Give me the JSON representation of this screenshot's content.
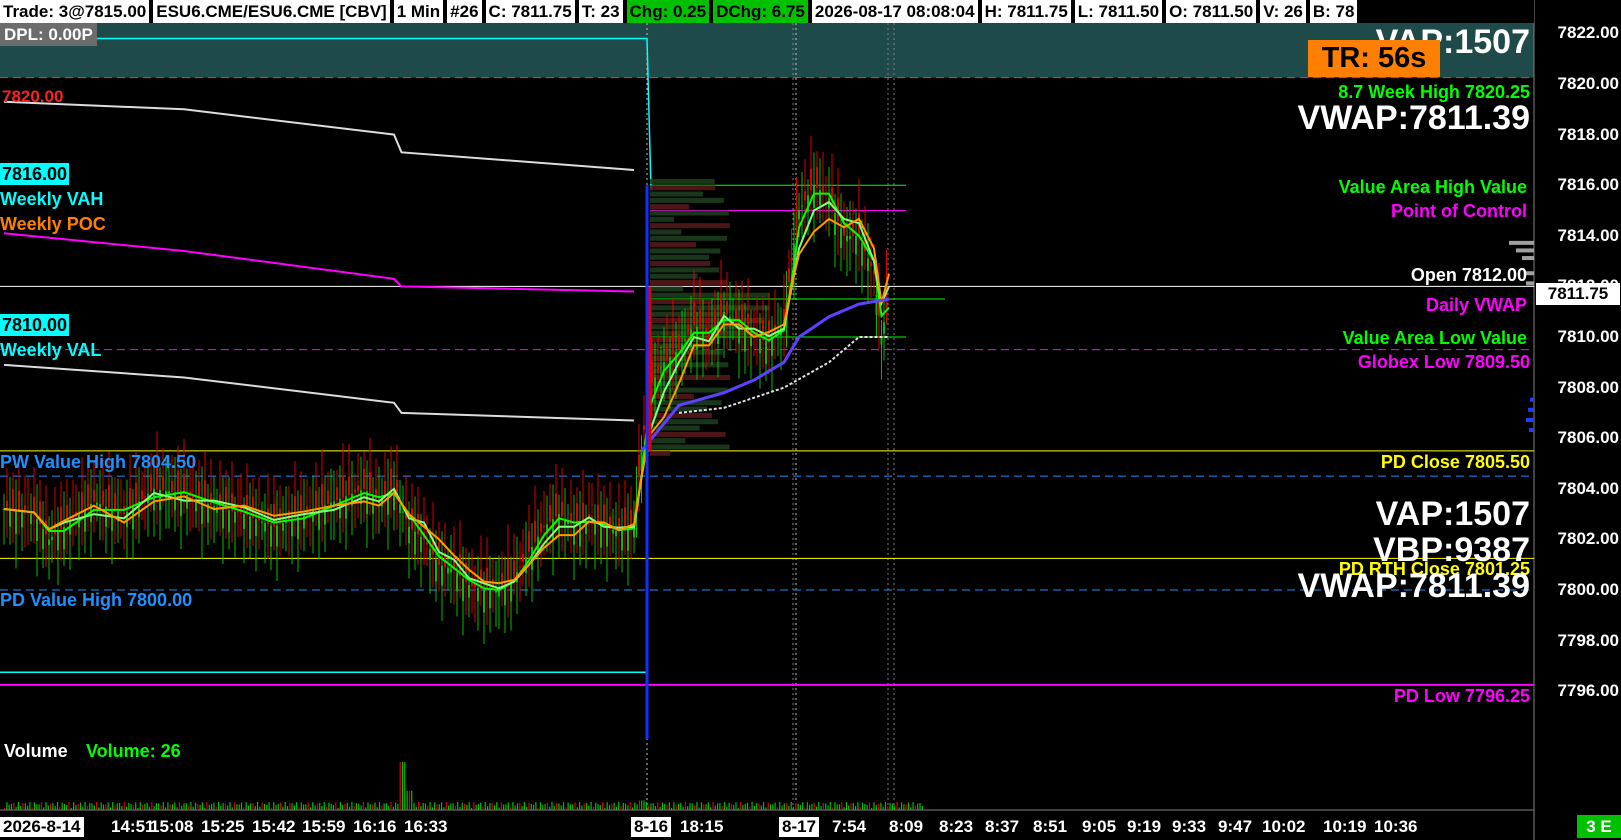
{
  "header": {
    "trade": "Trade: 3@7815.00",
    "symbol": "ESU6.CME/ESU6.CME [CBV]",
    "interval": "1 Min",
    "bar_number": "#26",
    "close": "C: 7811.75",
    "ticks": "T: 23",
    "change": "Chg: 0.25",
    "day_change": "DChg: 6.75",
    "datetime": "2026-08-17 08:08:04",
    "high": "H: 7811.75",
    "low": "L: 7811.50",
    "open": "O: 7811.50",
    "volume": "V: 26",
    "bid": "B: 78"
  },
  "dpl": "DPL: 0.00P",
  "timer": "TR: 56s",
  "stats": {
    "vap": "VAP:1507",
    "vbp": "VBP:9387",
    "vwap": "VWAP:7811.39"
  },
  "left_labels": {
    "level_7820": "7820.00",
    "level_7816": "7816.00",
    "weekly_vah": "Weekly VAH",
    "weekly_poc": "Weekly POC",
    "level_7810": "7810.00",
    "weekly_val": "Weekly VAL",
    "pw_value_high": "PW Value High  7804.50",
    "pd_value_high": "PD Value High  7800.00"
  },
  "right_labels": {
    "week_high": "8.7 Week High  7820.25",
    "vah": "Value Area High Value",
    "poc": "Point of Control",
    "open": "Open  7812.00",
    "daily_vwap": "Daily VWAP",
    "val": "Value Area Low Value",
    "globex_low": "Globex Low  7809.50",
    "pd_close": "PD Close  7805.50",
    "pd_rth_close": "PD RTH Close  7801.25",
    "pd_low": "PD Low  7796.25"
  },
  "price_axis": {
    "ticks": [
      "7822.00",
      "7820.00",
      "7818.00",
      "7816.00",
      "7814.00",
      "7812.00",
      "7810.00",
      "7808.00",
      "7806.00",
      "7804.00",
      "7802.00",
      "7800.00",
      "7798.00",
      "7796.00"
    ],
    "last_price": "7811.75"
  },
  "time_axis": {
    "labels": [
      "2026-8-14",
      "14:51",
      "15:08",
      "15:25",
      "15:42",
      "15:59",
      "16:16",
      "16:33",
      "8-16",
      "18:15",
      "8-17",
      "7:54",
      "8:09",
      "8:23",
      "8:37",
      "8:51",
      "9:05",
      "9:19",
      "9:33",
      "9:47",
      "10:02",
      "10:19",
      "10:36"
    ]
  },
  "volume_panel": {
    "title": "Volume",
    "value": "Volume: 26"
  },
  "corner": "3 E",
  "colors": {
    "background": "#000000",
    "cyan": "#00ffff",
    "magenta": "#ff00ff",
    "yellow": "#ffff00",
    "green": "#00ff00",
    "orange": "#ff8000",
    "red": "#ff0000",
    "blue": "#1e90ff",
    "teal_band": "#1f4a4a"
  },
  "chart_data": {
    "type": "line",
    "price_range": [
      7794,
      7822.5
    ],
    "levels": [
      {
        "price": 7820.25,
        "color": "#ff3030",
        "dash": true
      },
      {
        "price": 7816.0,
        "color": "#00ff00",
        "dash": false
      },
      {
        "price": 7815.0,
        "color": "#ff00ff",
        "dash": false
      },
      {
        "price": 7812.0,
        "color": "#ffffff",
        "dash": false
      },
      {
        "price": 7811.5,
        "color": "#00ff00",
        "dash": false
      },
      {
        "price": 7810.0,
        "color": "#00ff00",
        "dash": false
      },
      {
        "price": 7809.5,
        "color": "#ff00ff",
        "dash": true
      },
      {
        "price": 7805.5,
        "color": "#ffff00",
        "dash": false
      },
      {
        "price": 7804.5,
        "color": "#1e90ff",
        "dash": true
      },
      {
        "price": 7801.25,
        "color": "#ffff00",
        "dash": false
      },
      {
        "price": 7800.0,
        "color": "#1e90ff",
        "dash": true
      },
      {
        "price": 7796.25,
        "color": "#ff00ff",
        "dash": false
      }
    ],
    "weekly_vah_curve": [
      [
        0,
        7819.3
      ],
      [
        12,
        7819.0
      ],
      [
        26,
        7818.0
      ],
      [
        26.5,
        7817.3
      ],
      [
        42,
        7816.6
      ]
    ],
    "weekly_poc_curve": [
      [
        0,
        7814.1
      ],
      [
        12,
        7813.4
      ],
      [
        26,
        7812.3
      ],
      [
        26.5,
        7812.0
      ],
      [
        42,
        7811.8
      ]
    ],
    "weekly_val_curve": [
      [
        0,
        7808.9
      ],
      [
        12,
        7808.4
      ],
      [
        26,
        7807.4
      ],
      [
        26.5,
        7807.0
      ],
      [
        42,
        7806.7
      ]
    ],
    "vwap_path": [
      [
        42.5,
        7805.5
      ],
      [
        45,
        7807.3
      ],
      [
        48,
        7807.8
      ],
      [
        50,
        7808.3
      ],
      [
        52,
        7809.0
      ],
      [
        53,
        7810.0
      ],
      [
        55,
        7810.8
      ],
      [
        57,
        7811.3
      ],
      [
        59,
        7811.5
      ]
    ],
    "white_step_path": [
      [
        45,
        7807.0
      ],
      [
        48,
        7807.2
      ],
      [
        52,
        7808.0
      ],
      [
        55,
        7809.0
      ],
      [
        57,
        7810.0
      ],
      [
        59,
        7810.0
      ]
    ],
    "close_path": [
      [
        0,
        7803.2
      ],
      [
        2,
        7803.0
      ],
      [
        3,
        7802.0
      ],
      [
        4,
        7802.5
      ],
      [
        6,
        7803.5
      ],
      [
        8,
        7803.0
      ],
      [
        10,
        7804.0
      ],
      [
        12,
        7803.8
      ],
      [
        14,
        7803.3
      ],
      [
        16,
        7803.0
      ],
      [
        18,
        7802.5
      ],
      [
        20,
        7803.0
      ],
      [
        22,
        7803.5
      ],
      [
        24,
        7804.0
      ],
      [
        25,
        7803.5
      ],
      [
        26,
        7804.0
      ],
      [
        27,
        7802.5
      ],
      [
        28,
        7802.0
      ],
      [
        29,
        7801.0
      ],
      [
        30,
        7800.8
      ],
      [
        31,
        7800.2
      ],
      [
        32,
        7800.0
      ],
      [
        33,
        7800.0
      ],
      [
        34,
        7800.5
      ],
      [
        35,
        7801.5
      ],
      [
        36,
        7802.5
      ],
      [
        37,
        7803.0
      ],
      [
        38,
        7802.5
      ],
      [
        39,
        7802.8
      ],
      [
        40,
        7802.5
      ],
      [
        41,
        7802.3
      ],
      [
        42,
        7802.5
      ],
      [
        42.5,
        7805.5
      ],
      [
        43,
        7808.0
      ],
      [
        44,
        7809.0
      ],
      [
        45,
        7809.5
      ],
      [
        46,
        7810.5
      ],
      [
        47,
        7810.0
      ],
      [
        48,
        7811.0
      ],
      [
        49,
        7810.5
      ],
      [
        50,
        7810.0
      ],
      [
        51,
        7809.8
      ],
      [
        52,
        7810.5
      ],
      [
        52.5,
        7813.0
      ],
      [
        53,
        7815.0
      ],
      [
        54,
        7816.0
      ],
      [
        55,
        7815.5
      ],
      [
        56,
        7814.0
      ],
      [
        57,
        7814.0
      ],
      [
        58,
        7812.5
      ],
      [
        58.5,
        7810.0
      ],
      [
        59,
        7811.75
      ]
    ],
    "volume_spikes": [
      [
        26.5,
        20
      ],
      [
        27,
        8
      ],
      [
        42.5,
        4
      ]
    ]
  }
}
